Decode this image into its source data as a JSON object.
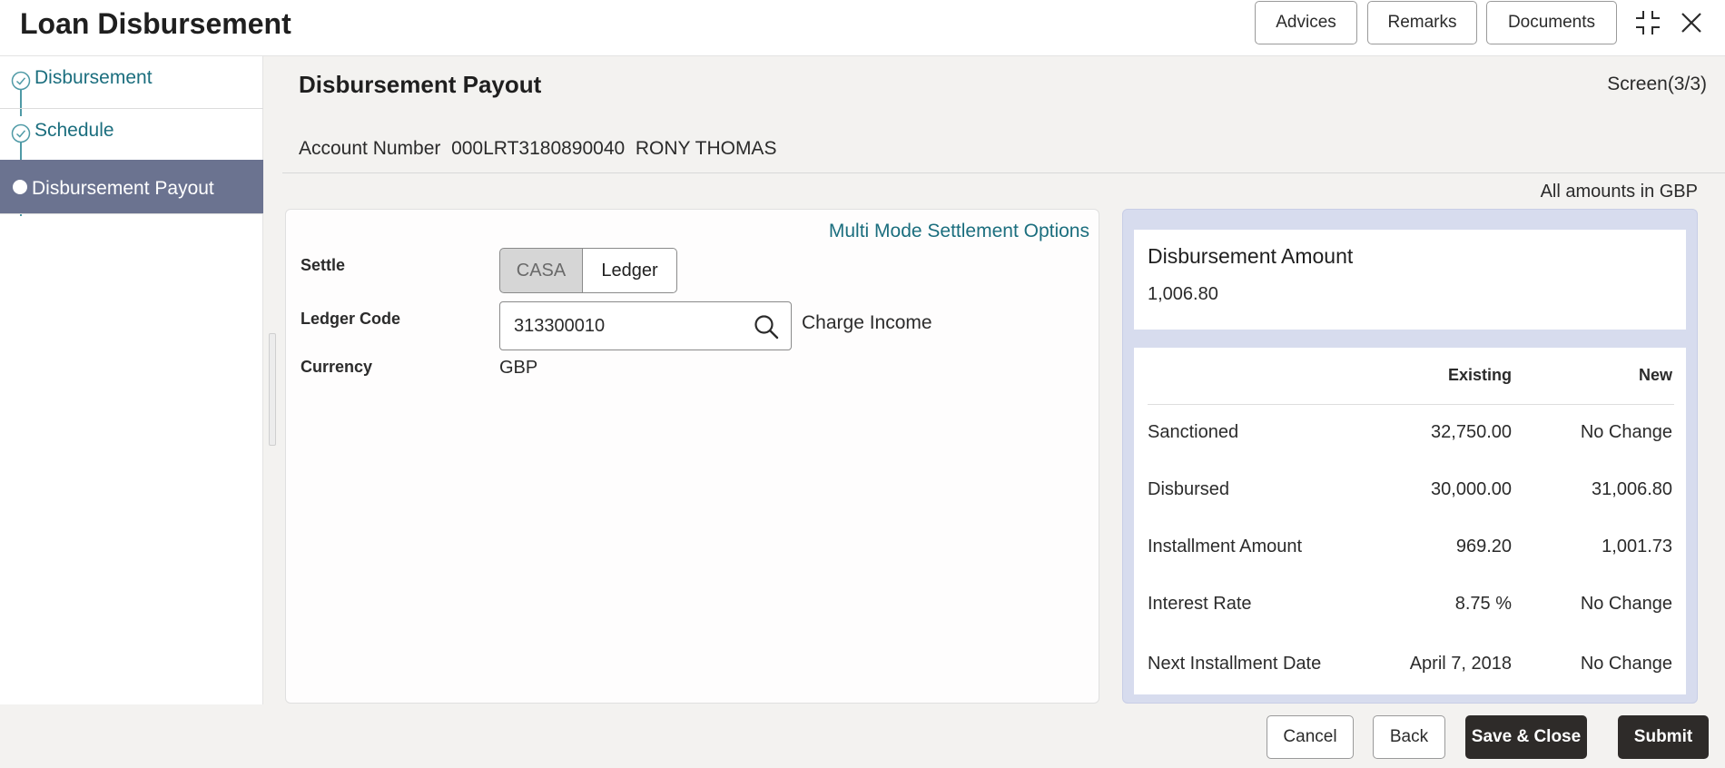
{
  "app": {
    "title": "Loan Disbursement"
  },
  "header": {
    "buttons": {
      "advices": "Advices",
      "remarks": "Remarks",
      "documents": "Documents"
    },
    "icons": {
      "minimize": "minimize-icon",
      "close": "close-icon"
    }
  },
  "sidebar": {
    "items": [
      {
        "label": "Disbursement",
        "state": "completed"
      },
      {
        "label": "Schedule",
        "state": "completed"
      },
      {
        "label": "Disbursement Payout",
        "state": "active"
      }
    ]
  },
  "main": {
    "title": "Disbursement Payout",
    "screen_indicator": "Screen(3/3)",
    "account_line": "Account Number  000LRT3180890040  RONY THOMAS",
    "amounts_note": "All amounts in GBP"
  },
  "form": {
    "multi_mode_link": "Multi Mode Settlement Options",
    "settle": {
      "label": "Settle",
      "options": [
        "CASA",
        "Ledger"
      ],
      "selected": "Ledger"
    },
    "ledger_code": {
      "label": "Ledger Code",
      "value": "313300010",
      "description": "Charge Income"
    },
    "currency": {
      "label": "Currency",
      "value": "GBP"
    }
  },
  "summary": {
    "disbursement_amount": {
      "title": "Disbursement Amount",
      "value": "1,006.80"
    },
    "table": {
      "headers": [
        "",
        "Existing",
        "New"
      ],
      "rows": [
        [
          "Sanctioned",
          "32,750.00",
          "No Change"
        ],
        [
          "Disbursed",
          "30,000.00",
          "31,006.80"
        ],
        [
          "Installment Amount",
          "969.20",
          "1,001.73"
        ],
        [
          "Interest Rate",
          "8.75 %",
          "No Change"
        ],
        [
          "Next Installment Date",
          "April 7, 2018",
          "No Change"
        ]
      ]
    }
  },
  "footer": {
    "cancel": "Cancel",
    "back": "Back",
    "save_close": "Save & Close",
    "submit": "Submit"
  },
  "colors": {
    "accent": "#1b6e7e",
    "active_step_bg": "#6b7390",
    "summary_panel_bg": "#d7dcee",
    "primary_button": "#2e2b29"
  }
}
